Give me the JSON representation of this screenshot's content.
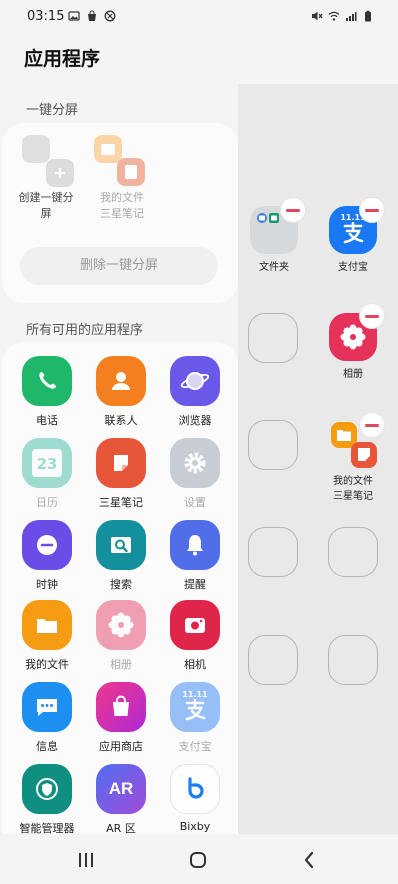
{
  "status_bar": {
    "time": "03:15"
  },
  "page_title": "应用程序",
  "split_section": {
    "label": "一键分屏",
    "create_label": "创建一键分屏",
    "pair_line1": "我的文件",
    "pair_line2": "三星笔记",
    "delete_button": "删除一键分屏"
  },
  "apps_section": {
    "label": "所有可用的应用程序",
    "apps": [
      {
        "label": "电话"
      },
      {
        "label": "联系人"
      },
      {
        "label": "浏览器"
      },
      {
        "label": "日历",
        "badge": "23"
      },
      {
        "label": "三星笔记"
      },
      {
        "label": "设置"
      },
      {
        "label": "时钟"
      },
      {
        "label": "搜索"
      },
      {
        "label": "提醒"
      },
      {
        "label": "我的文件"
      },
      {
        "label": "相册"
      },
      {
        "label": "相机"
      },
      {
        "label": "信息"
      },
      {
        "label": "应用商店"
      },
      {
        "label": "支付宝",
        "badge": "11.11"
      },
      {
        "label": "智能管理器"
      },
      {
        "label": "AR 区",
        "badge": "AR"
      },
      {
        "label": "Bixby"
      }
    ]
  },
  "edge_panel": {
    "folder": "文件夹",
    "alipay": "支付宝",
    "alipay_badge": "11.11",
    "gallery": "相册",
    "pair_line1": "我的文件",
    "pair_line2": "三星笔记"
  }
}
